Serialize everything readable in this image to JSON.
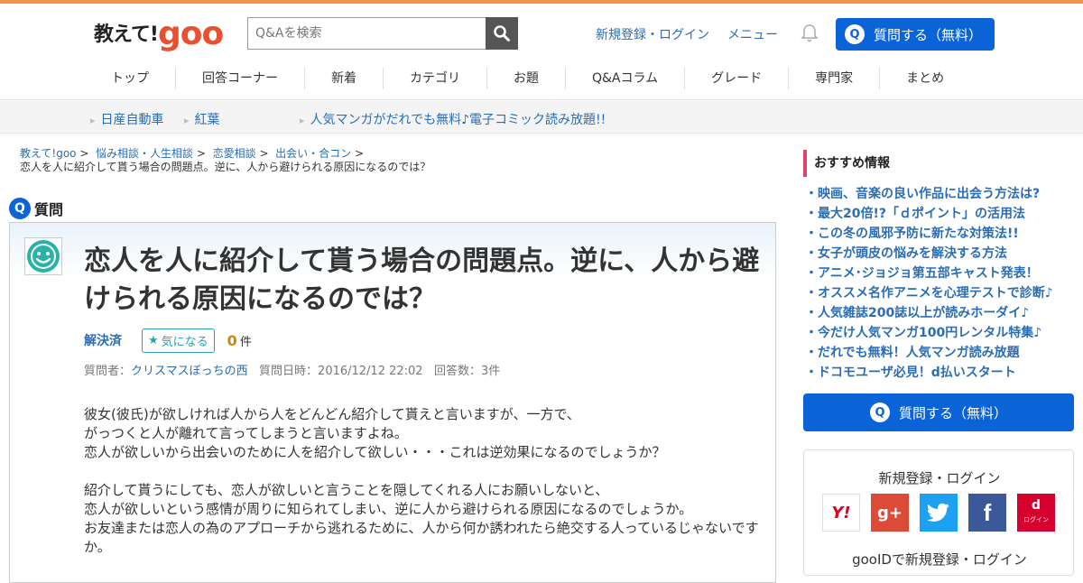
{
  "header": {
    "logo_jp": "教えて!",
    "logo_goo": "goo",
    "search_placeholder": "Q&Aを検索",
    "register_login": "新規登録・ログイン",
    "menu": "メニュー",
    "ask_button": "質問する（無料）",
    "ask_icon": "Q"
  },
  "nav": [
    "トップ",
    "回答コーナー",
    "新着",
    "カテゴリ",
    "お題",
    "Q&Aコラム",
    "グレード",
    "専門家",
    "まとめ"
  ],
  "subbar": {
    "link1": "日産自動車",
    "link2": "紅葉",
    "link3": "人気マンガがだれでも無料♪電子コミック読み放題!!"
  },
  "breadcrumb": {
    "c1": "教えて!goo",
    "c2": "悩み相談・人生相談",
    "c3": "恋愛相談",
    "c4": "出会い・合コン",
    "sep": ">",
    "current": "恋人を人に紹介して貰う場合の問題点。逆に、人から避けられる原因になるのでは？"
  },
  "question": {
    "label": "質問",
    "icon": "Q",
    "title": "恋人を人に紹介して貰う場合の問題点。逆に、人から避けられる原因になるのでは？",
    "status": "解決済",
    "watch_label": "気になる",
    "watch_count": "0",
    "watch_unit": "件",
    "asker_label": "質問者：",
    "asker": "クリスマスぼっちの西",
    "date": "質問日時：2016/12/12 22:02",
    "answers": "回答数：3件",
    "body_p1": [
      "彼女(彼氏)が欲しければ人から人をどんどん紹介して貰えと言いますが、一方で、",
      "がっつくと人が離れて言ってしまうと言いますよね。",
      "恋人が欲しいから出会いのために人を紹介して欲しい・・・これは逆効果になるのでしょうか？"
    ],
    "body_p2": [
      "紹介して貰うにしても、恋人が欲しいと言うことを隠してくれる人にお願いしないと、",
      "恋人が欲しいという感情が周りに知られてしまい、逆に人から避けられる原因になるのでしょうか。",
      "お友達または恋人の為のアプローチから逃れるために、人から何か誘われたら絶交する人っているじゃないですか。"
    ]
  },
  "sidebar": {
    "title": "おすすめ情報",
    "items": [
      "映画、音楽の良い作品に出会う方法は?",
      "最大20倍!?「ｄポイント」の活用法",
      "この冬の風邪予防に新たな対策法!!",
      "女子が頭皮の悩みを解決する方法",
      "アニメ･ジョジョ第五部キャスト発表！",
      "オススメ名作アニメを心理テストで診断♪",
      "人気雑誌200誌以上が読みホーダイ♪",
      "今だけ人気マンガ100円レンタル特集♪",
      "だれでも無料！人気マンガ読み放題",
      "ドコモユーザ必見！d払いスタート"
    ],
    "ask_button": "質問する（無料）",
    "login_title": "新規登録・ログイン",
    "social": {
      "yahoo": "Y!",
      "google": "g+",
      "facebook": "f",
      "docomo": "d",
      "docomo_sub": "ログイン"
    },
    "gooid": "gooIDで新規登録・ログイン"
  },
  "colors": {
    "accent": "#0a64d8",
    "link": "#2a6db5",
    "top_stripe": "#f39345",
    "logo_red": "#e8502e"
  }
}
